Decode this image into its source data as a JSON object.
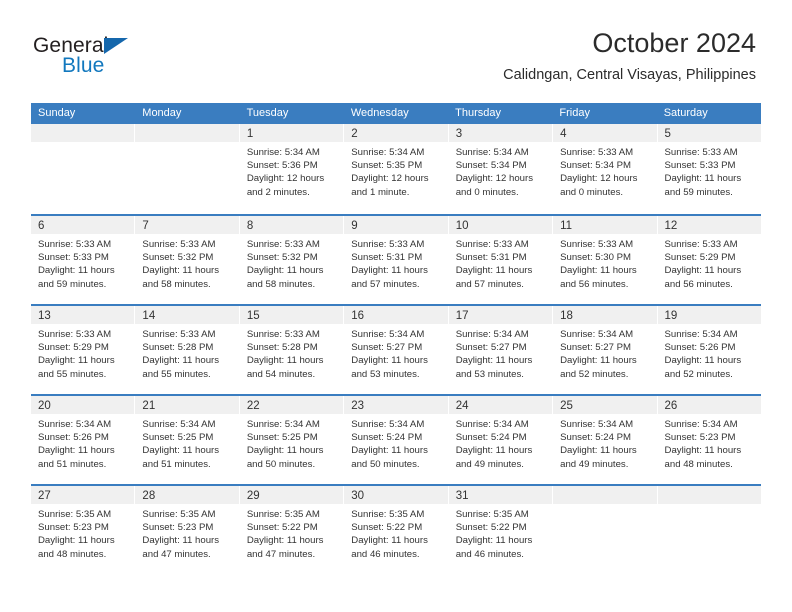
{
  "brand": {
    "name_part1": "General",
    "name_part2": "Blue",
    "triangle_icon": "triangle-icon",
    "accent_color": "#1278be"
  },
  "header": {
    "title": "October 2024",
    "location": "Calidngan, Central Visayas, Philippines"
  },
  "calendar": {
    "header_color": "#3a7dc0",
    "daynum_band_color": "#f0f0f0",
    "weekday_headers": [
      "Sunday",
      "Monday",
      "Tuesday",
      "Wednesday",
      "Thursday",
      "Friday",
      "Saturday"
    ],
    "weeks": [
      [
        {
          "day": "",
          "sunrise": "",
          "sunset": "",
          "daylight_line1": "",
          "daylight_line2": ""
        },
        {
          "day": "",
          "sunrise": "",
          "sunset": "",
          "daylight_line1": "",
          "daylight_line2": ""
        },
        {
          "day": "1",
          "sunrise": "Sunrise: 5:34 AM",
          "sunset": "Sunset: 5:36 PM",
          "daylight_line1": "Daylight: 12 hours",
          "daylight_line2": "and 2 minutes."
        },
        {
          "day": "2",
          "sunrise": "Sunrise: 5:34 AM",
          "sunset": "Sunset: 5:35 PM",
          "daylight_line1": "Daylight: 12 hours",
          "daylight_line2": "and 1 minute."
        },
        {
          "day": "3",
          "sunrise": "Sunrise: 5:34 AM",
          "sunset": "Sunset: 5:34 PM",
          "daylight_line1": "Daylight: 12 hours",
          "daylight_line2": "and 0 minutes."
        },
        {
          "day": "4",
          "sunrise": "Sunrise: 5:33 AM",
          "sunset": "Sunset: 5:34 PM",
          "daylight_line1": "Daylight: 12 hours",
          "daylight_line2": "and 0 minutes."
        },
        {
          "day": "5",
          "sunrise": "Sunrise: 5:33 AM",
          "sunset": "Sunset: 5:33 PM",
          "daylight_line1": "Daylight: 11 hours",
          "daylight_line2": "and 59 minutes."
        }
      ],
      [
        {
          "day": "6",
          "sunrise": "Sunrise: 5:33 AM",
          "sunset": "Sunset: 5:33 PM",
          "daylight_line1": "Daylight: 11 hours",
          "daylight_line2": "and 59 minutes."
        },
        {
          "day": "7",
          "sunrise": "Sunrise: 5:33 AM",
          "sunset": "Sunset: 5:32 PM",
          "daylight_line1": "Daylight: 11 hours",
          "daylight_line2": "and 58 minutes."
        },
        {
          "day": "8",
          "sunrise": "Sunrise: 5:33 AM",
          "sunset": "Sunset: 5:32 PM",
          "daylight_line1": "Daylight: 11 hours",
          "daylight_line2": "and 58 minutes."
        },
        {
          "day": "9",
          "sunrise": "Sunrise: 5:33 AM",
          "sunset": "Sunset: 5:31 PM",
          "daylight_line1": "Daylight: 11 hours",
          "daylight_line2": "and 57 minutes."
        },
        {
          "day": "10",
          "sunrise": "Sunrise: 5:33 AM",
          "sunset": "Sunset: 5:31 PM",
          "daylight_line1": "Daylight: 11 hours",
          "daylight_line2": "and 57 minutes."
        },
        {
          "day": "11",
          "sunrise": "Sunrise: 5:33 AM",
          "sunset": "Sunset: 5:30 PM",
          "daylight_line1": "Daylight: 11 hours",
          "daylight_line2": "and 56 minutes."
        },
        {
          "day": "12",
          "sunrise": "Sunrise: 5:33 AM",
          "sunset": "Sunset: 5:29 PM",
          "daylight_line1": "Daylight: 11 hours",
          "daylight_line2": "and 56 minutes."
        }
      ],
      [
        {
          "day": "13",
          "sunrise": "Sunrise: 5:33 AM",
          "sunset": "Sunset: 5:29 PM",
          "daylight_line1": "Daylight: 11 hours",
          "daylight_line2": "and 55 minutes."
        },
        {
          "day": "14",
          "sunrise": "Sunrise: 5:33 AM",
          "sunset": "Sunset: 5:28 PM",
          "daylight_line1": "Daylight: 11 hours",
          "daylight_line2": "and 55 minutes."
        },
        {
          "day": "15",
          "sunrise": "Sunrise: 5:33 AM",
          "sunset": "Sunset: 5:28 PM",
          "daylight_line1": "Daylight: 11 hours",
          "daylight_line2": "and 54 minutes."
        },
        {
          "day": "16",
          "sunrise": "Sunrise: 5:34 AM",
          "sunset": "Sunset: 5:27 PM",
          "daylight_line1": "Daylight: 11 hours",
          "daylight_line2": "and 53 minutes."
        },
        {
          "day": "17",
          "sunrise": "Sunrise: 5:34 AM",
          "sunset": "Sunset: 5:27 PM",
          "daylight_line1": "Daylight: 11 hours",
          "daylight_line2": "and 53 minutes."
        },
        {
          "day": "18",
          "sunrise": "Sunrise: 5:34 AM",
          "sunset": "Sunset: 5:27 PM",
          "daylight_line1": "Daylight: 11 hours",
          "daylight_line2": "and 52 minutes."
        },
        {
          "day": "19",
          "sunrise": "Sunrise: 5:34 AM",
          "sunset": "Sunset: 5:26 PM",
          "daylight_line1": "Daylight: 11 hours",
          "daylight_line2": "and 52 minutes."
        }
      ],
      [
        {
          "day": "20",
          "sunrise": "Sunrise: 5:34 AM",
          "sunset": "Sunset: 5:26 PM",
          "daylight_line1": "Daylight: 11 hours",
          "daylight_line2": "and 51 minutes."
        },
        {
          "day": "21",
          "sunrise": "Sunrise: 5:34 AM",
          "sunset": "Sunset: 5:25 PM",
          "daylight_line1": "Daylight: 11 hours",
          "daylight_line2": "and 51 minutes."
        },
        {
          "day": "22",
          "sunrise": "Sunrise: 5:34 AM",
          "sunset": "Sunset: 5:25 PM",
          "daylight_line1": "Daylight: 11 hours",
          "daylight_line2": "and 50 minutes."
        },
        {
          "day": "23",
          "sunrise": "Sunrise: 5:34 AM",
          "sunset": "Sunset: 5:24 PM",
          "daylight_line1": "Daylight: 11 hours",
          "daylight_line2": "and 50 minutes."
        },
        {
          "day": "24",
          "sunrise": "Sunrise: 5:34 AM",
          "sunset": "Sunset: 5:24 PM",
          "daylight_line1": "Daylight: 11 hours",
          "daylight_line2": "and 49 minutes."
        },
        {
          "day": "25",
          "sunrise": "Sunrise: 5:34 AM",
          "sunset": "Sunset: 5:24 PM",
          "daylight_line1": "Daylight: 11 hours",
          "daylight_line2": "and 49 minutes."
        },
        {
          "day": "26",
          "sunrise": "Sunrise: 5:34 AM",
          "sunset": "Sunset: 5:23 PM",
          "daylight_line1": "Daylight: 11 hours",
          "daylight_line2": "and 48 minutes."
        }
      ],
      [
        {
          "day": "27",
          "sunrise": "Sunrise: 5:35 AM",
          "sunset": "Sunset: 5:23 PM",
          "daylight_line1": "Daylight: 11 hours",
          "daylight_line2": "and 48 minutes."
        },
        {
          "day": "28",
          "sunrise": "Sunrise: 5:35 AM",
          "sunset": "Sunset: 5:23 PM",
          "daylight_line1": "Daylight: 11 hours",
          "daylight_line2": "and 47 minutes."
        },
        {
          "day": "29",
          "sunrise": "Sunrise: 5:35 AM",
          "sunset": "Sunset: 5:22 PM",
          "daylight_line1": "Daylight: 11 hours",
          "daylight_line2": "and 47 minutes."
        },
        {
          "day": "30",
          "sunrise": "Sunrise: 5:35 AM",
          "sunset": "Sunset: 5:22 PM",
          "daylight_line1": "Daylight: 11 hours",
          "daylight_line2": "and 46 minutes."
        },
        {
          "day": "31",
          "sunrise": "Sunrise: 5:35 AM",
          "sunset": "Sunset: 5:22 PM",
          "daylight_line1": "Daylight: 11 hours",
          "daylight_line2": "and 46 minutes."
        },
        {
          "day": "",
          "sunrise": "",
          "sunset": "",
          "daylight_line1": "",
          "daylight_line2": ""
        },
        {
          "day": "",
          "sunrise": "",
          "sunset": "",
          "daylight_line1": "",
          "daylight_line2": ""
        }
      ]
    ]
  }
}
